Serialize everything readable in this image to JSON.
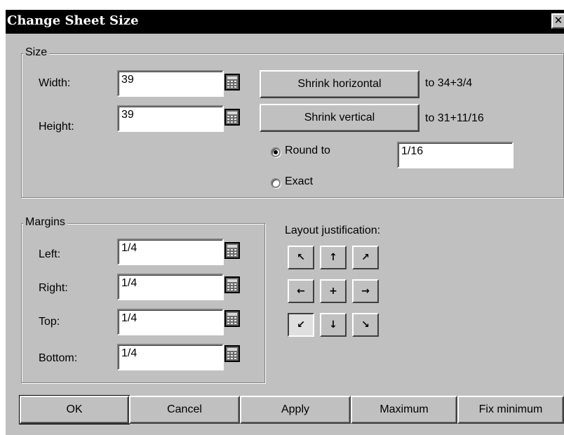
{
  "dialog": {
    "title": "Change Sheet Size",
    "close_glyph": "✕"
  },
  "size_group": {
    "legend": "Size",
    "width_label": "Width:",
    "width_value": "39",
    "height_label": "Height:",
    "height_value": "39",
    "shrink_horizontal_label": "Shrink horizontal",
    "shrink_horizontal_result": "to 34+3/4",
    "shrink_vertical_label": "Shrink vertical",
    "shrink_vertical_result": "to 31+11/16",
    "round_to_label": "Round to",
    "round_to_value": "1/16",
    "exact_label": "Exact",
    "selected_rounding": "Round to"
  },
  "margins_group": {
    "legend": "Margins",
    "left_label": "Left:",
    "left_value": "1/4",
    "right_label": "Right:",
    "right_value": "1/4",
    "top_label": "Top:",
    "top_value": "1/4",
    "bottom_label": "Bottom:",
    "bottom_value": "1/4"
  },
  "layout_justification": {
    "label": "Layout justification:",
    "glyphs": [
      "↖",
      "↑",
      "↗",
      "←",
      "+",
      "→",
      "↙",
      "↓",
      "↘"
    ],
    "selected": "bottom-left"
  },
  "buttons": {
    "ok": "OK",
    "cancel": "Cancel",
    "apply": "Apply",
    "maximum": "Maximum",
    "fix_minimum": "Fix minimum"
  }
}
